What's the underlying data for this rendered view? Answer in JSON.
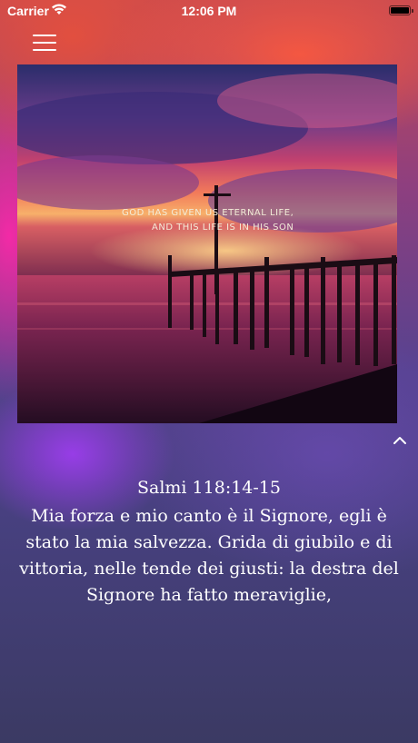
{
  "status_bar": {
    "carrier": "Carrier",
    "time": "12:06 PM"
  },
  "header": {
    "menu_icon": "hamburger-menu-icon"
  },
  "image": {
    "overlay_line1": "GOD HAS GIVEN US ETERNAL LIFE,",
    "overlay_line2": "AND THIS LIFE IS IN HIS SON"
  },
  "verse": {
    "reference": "Salmi 118:14-15",
    "text": "Mia forza e mio canto è il Signore, egli è stato la mia salvezza. Grida di giubilo e di vittoria, nelle tende dei giusti: la destra del Signore ha fatto meraviglie,"
  },
  "controls": {
    "collapse_icon": "chevron-up-icon"
  }
}
